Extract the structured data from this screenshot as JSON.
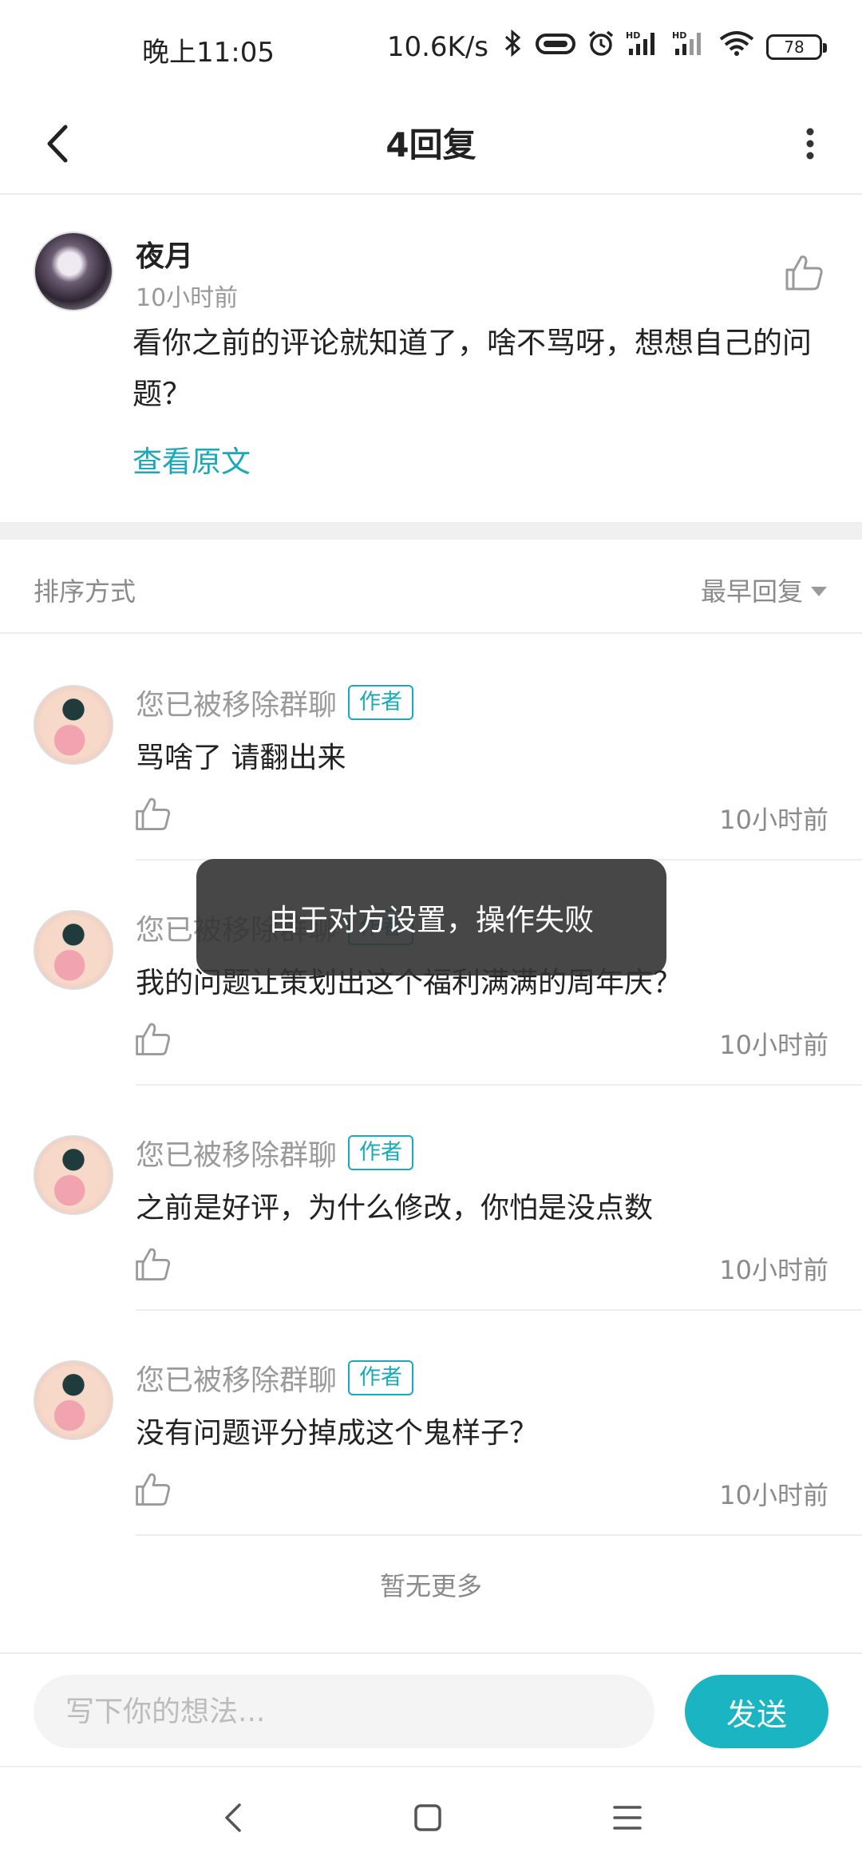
{
  "status_bar": {
    "time": "晚上11:05",
    "speed": "10.6K/s",
    "battery": "78",
    "icons": [
      "bluetooth-icon",
      "vibrate-icon",
      "alarm-icon",
      "signal-hd-icon",
      "signal-hd-icon",
      "wifi-icon",
      "battery-icon"
    ]
  },
  "header": {
    "title": "4回复",
    "back_icon": "chevron-left-icon",
    "more_icon": "more-vertical-icon"
  },
  "original_comment": {
    "name": "夜月",
    "time": "10小时前",
    "text": "看你之前的评论就知道了，啥不骂呀，想想自己的问题？",
    "link": "查看原文"
  },
  "sort": {
    "label": "排序方式",
    "value": "最早回复"
  },
  "replies": [
    {
      "name": "您已被移除群聊",
      "tag": "作者",
      "text": "骂啥了 请翻出来",
      "time": "10小时前"
    },
    {
      "name": "您已被移除群聊",
      "tag": "作者",
      "text": "我的问题让策划出这个福利满满的周年庆？",
      "time": "10小时前"
    },
    {
      "name": "您已被移除群聊",
      "tag": "作者",
      "text": "之前是好评，为什么修改，你怕是没点数",
      "time": "10小时前"
    },
    {
      "name": "您已被移除群聊",
      "tag": "作者",
      "text": "没有问题评分掉成这个鬼样子？",
      "time": "10小时前"
    }
  ],
  "no_more": "暂无更多",
  "toast": "由于对方设置，操作失败",
  "input": {
    "placeholder": "写下你的想法...",
    "value": "",
    "send_label": "发送"
  },
  "colors": {
    "accent": "#19a9b8",
    "send_button": "#1ab4c2",
    "toast_bg": "#333333"
  }
}
